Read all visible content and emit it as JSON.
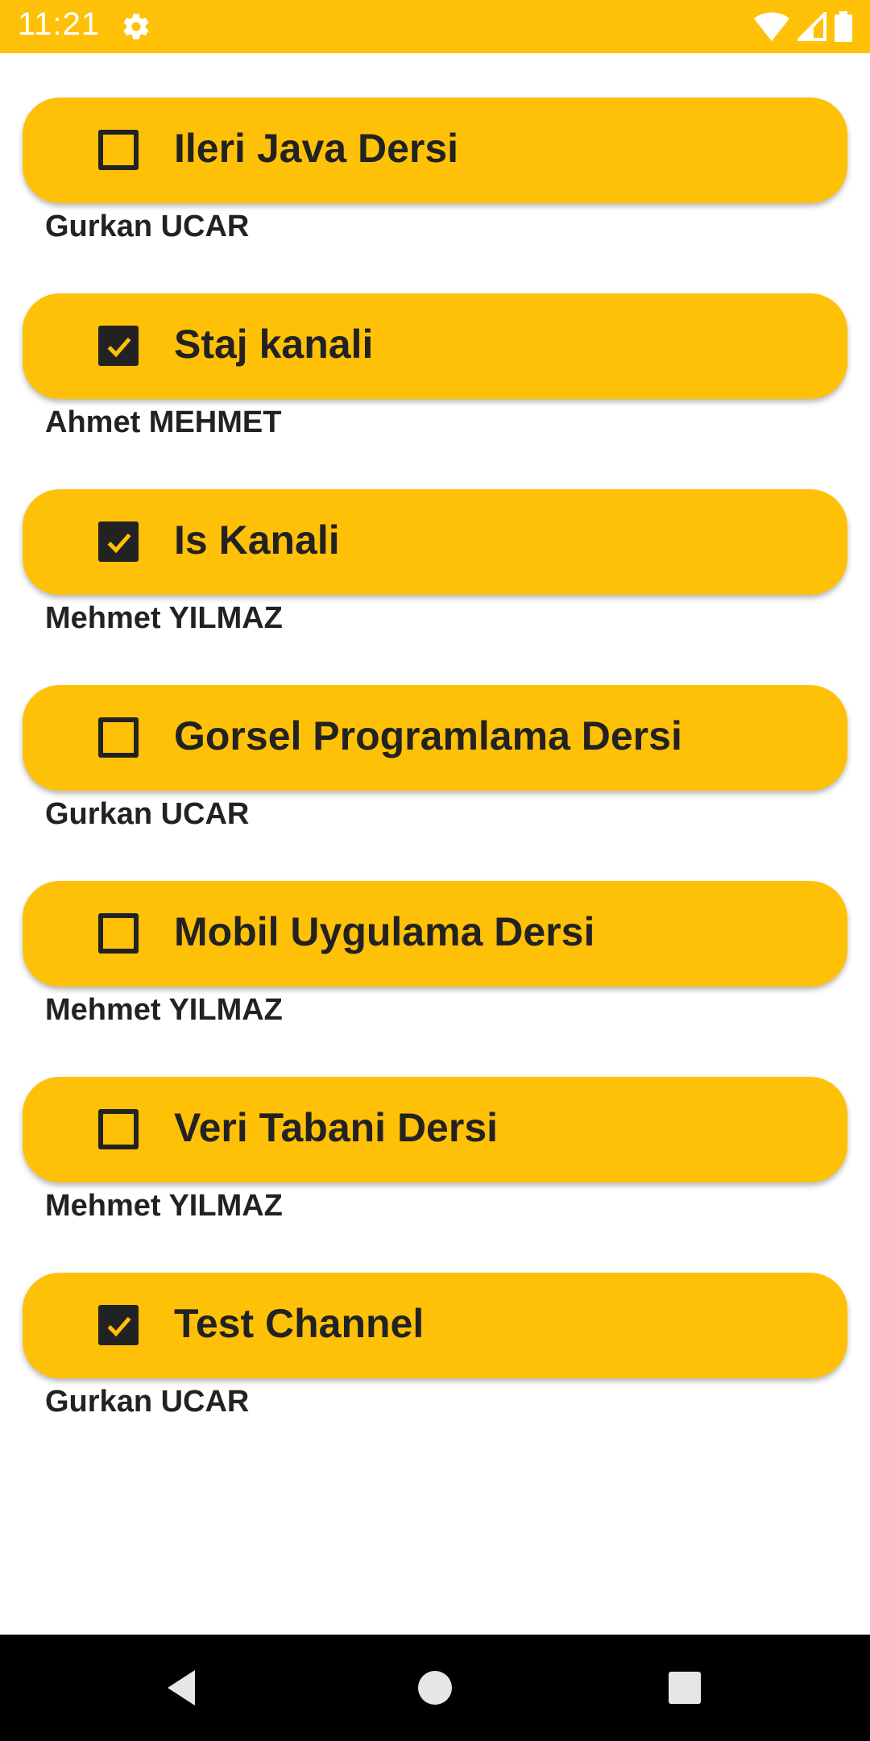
{
  "status_bar": {
    "time": "11:21",
    "icons": [
      "settings-icon",
      "wifi-icon",
      "signal-icon",
      "battery-icon"
    ],
    "background": "#FFC107"
  },
  "channels": [
    {
      "title": "Ileri Java Dersi",
      "owner": "Gurkan UCAR",
      "checked": false
    },
    {
      "title": "Staj kanali",
      "owner": "Ahmet MEHMET",
      "checked": true
    },
    {
      "title": "Is Kanali",
      "owner": "Mehmet YILMAZ",
      "checked": true
    },
    {
      "title": "Gorsel Programlama Dersi",
      "owner": "Gurkan UCAR",
      "checked": false
    },
    {
      "title": "Mobil Uygulama Dersi",
      "owner": "Mehmet YILMAZ",
      "checked": false
    },
    {
      "title": "Veri Tabani Dersi",
      "owner": "Mehmet YILMAZ",
      "checked": false
    },
    {
      "title": "Test Channel",
      "owner": "Gurkan UCAR",
      "checked": true
    }
  ],
  "nav_bar": {
    "buttons": [
      "back-icon",
      "home-icon",
      "recents-icon"
    ]
  },
  "colors": {
    "accent": "#FFC107",
    "text": "#222222",
    "background": "#FFFFFF"
  }
}
